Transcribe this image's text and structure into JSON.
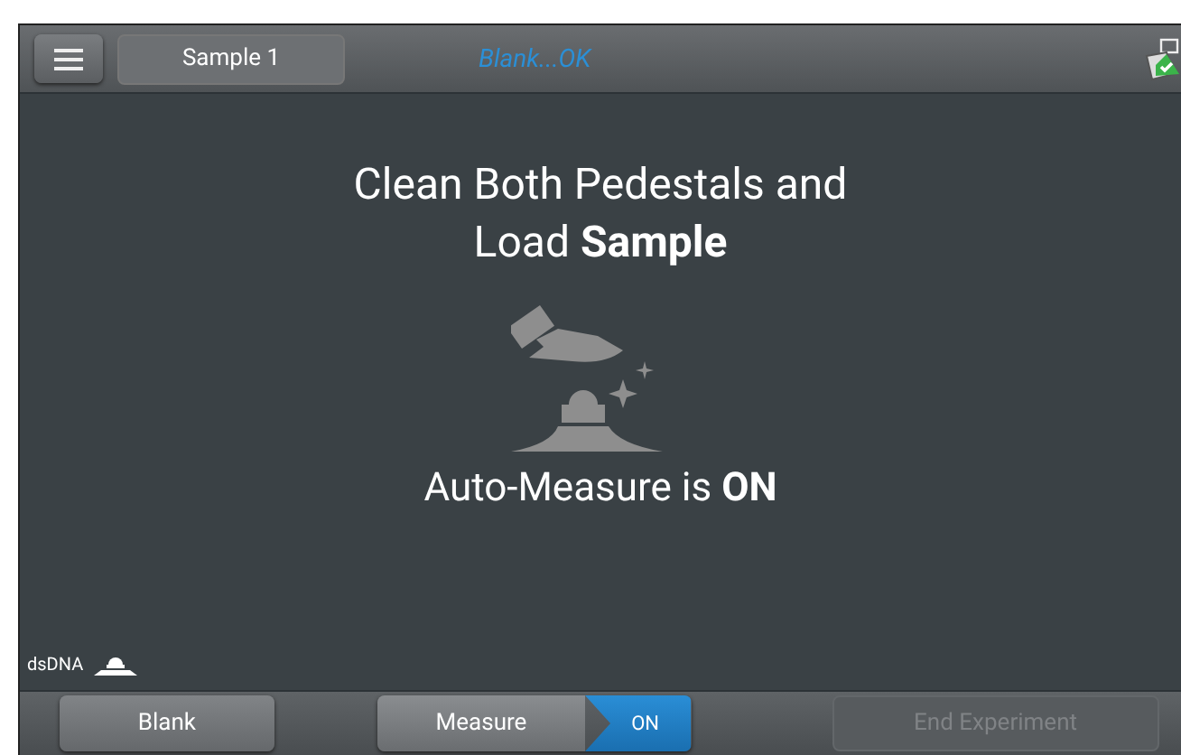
{
  "top_bar": {
    "sample_name": "Sample 1",
    "status": "Blank...OK"
  },
  "prompt": "Clean Both Pedestals and Load **Sample**",
  "auto_measure": "Auto-Measure is **ON**",
  "application": "dsDNA",
  "buttons": [
    {
      "kind": "plain",
      "label": "Blank",
      "disabled": false
    },
    {
      "kind": "toggle",
      "label": "Measure",
      "toggle": "ON",
      "on": true
    },
    {
      "kind": "plain",
      "label": "End Experiment",
      "disabled": true
    }
  ]
}
